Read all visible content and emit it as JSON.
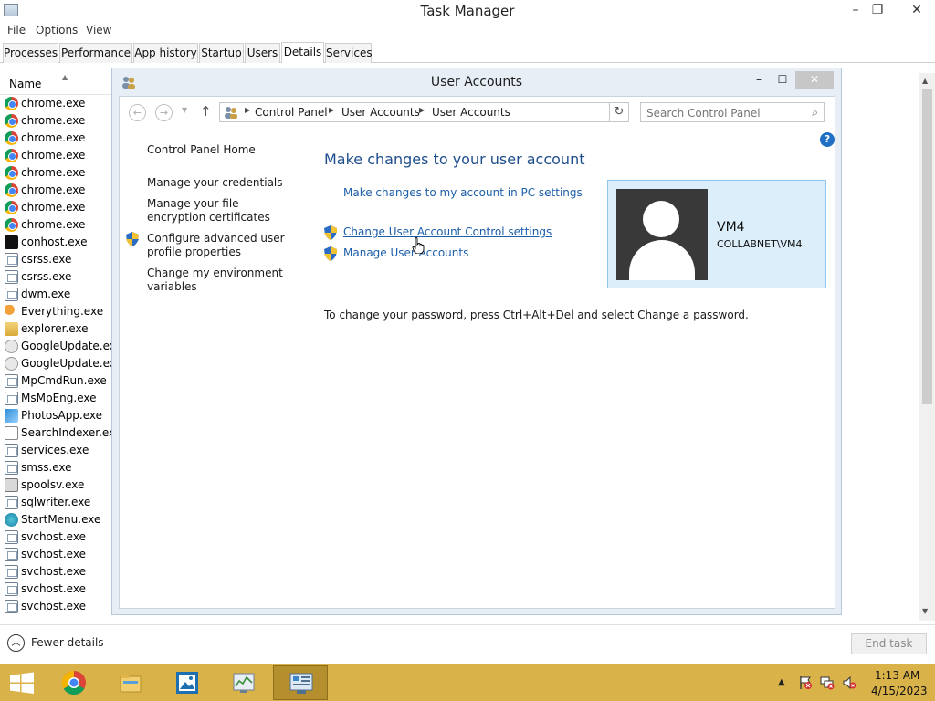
{
  "task_manager": {
    "title": "Task Manager",
    "menu": [
      "File",
      "Options",
      "View"
    ],
    "tabs": [
      "Processes",
      "Performance",
      "App history",
      "Startup",
      "Users",
      "Details",
      "Services"
    ],
    "active_tab": "Details",
    "column_header": "Name",
    "processes": [
      {
        "name": "chrome.exe",
        "icon": "chrome-icon"
      },
      {
        "name": "chrome.exe",
        "icon": "chrome-icon"
      },
      {
        "name": "chrome.exe",
        "icon": "chrome-icon"
      },
      {
        "name": "chrome.exe",
        "icon": "chrome-icon"
      },
      {
        "name": "chrome.exe",
        "icon": "chrome-icon"
      },
      {
        "name": "chrome.exe",
        "icon": "chrome-icon"
      },
      {
        "name": "chrome.exe",
        "icon": "chrome-icon"
      },
      {
        "name": "chrome.exe",
        "icon": "chrome-icon"
      },
      {
        "name": "conhost.exe",
        "icon": "console-icon"
      },
      {
        "name": "csrss.exe",
        "icon": "window-icon"
      },
      {
        "name": "csrss.exe",
        "icon": "window-icon"
      },
      {
        "name": "dwm.exe",
        "icon": "window-icon"
      },
      {
        "name": "Everything.exe",
        "icon": "magnifier-icon"
      },
      {
        "name": "explorer.exe",
        "icon": "folder-icon"
      },
      {
        "name": "GoogleUpdate.exe",
        "icon": "google-update-icon"
      },
      {
        "name": "GoogleUpdate.exe",
        "icon": "google-update-icon"
      },
      {
        "name": "MpCmdRun.exe",
        "icon": "window-icon"
      },
      {
        "name": "MsMpEng.exe",
        "icon": "window-icon"
      },
      {
        "name": "PhotosApp.exe",
        "icon": "photos-icon"
      },
      {
        "name": "SearchIndexer.exe",
        "icon": "search-indexer-icon"
      },
      {
        "name": "services.exe",
        "icon": "window-icon"
      },
      {
        "name": "smss.exe",
        "icon": "window-icon"
      },
      {
        "name": "spoolsv.exe",
        "icon": "printer-icon"
      },
      {
        "name": "sqlwriter.exe",
        "icon": "window-icon"
      },
      {
        "name": "StartMenu.exe",
        "icon": "startmenu-icon"
      },
      {
        "name": "svchost.exe",
        "icon": "window-icon"
      },
      {
        "name": "svchost.exe",
        "icon": "window-icon"
      },
      {
        "name": "svchost.exe",
        "icon": "window-icon"
      },
      {
        "name": "svchost.exe",
        "icon": "window-icon"
      },
      {
        "name": "svchost.exe",
        "icon": "window-icon"
      }
    ],
    "fewer_details": "Fewer details",
    "end_task": "End task"
  },
  "user_accounts": {
    "title": "User Accounts",
    "breadcrumbs": [
      "Control Panel",
      "User Accounts",
      "User Accounts"
    ],
    "search_placeholder": "Search Control Panel",
    "help": "?",
    "left_nav": {
      "home": "Control Panel Home",
      "credentials": "Manage your credentials",
      "encryption": "Manage your file encryption certificates",
      "profile": "Configure advanced user profile properties",
      "environment": "Change my environment variables"
    },
    "heading": "Make changes to your user account",
    "link_pc_settings": "Make changes to my account in PC settings",
    "link_uac": "Change User Account Control settings",
    "link_manage": "Manage User Accounts",
    "password_note": "To change your password, press Ctrl+Alt+Del and select Change a password.",
    "user": {
      "name": "VM4",
      "domain": "COLLABNET\\VM4"
    }
  },
  "taskbar": {
    "time": "1:13 AM",
    "date": "4/15/2023"
  },
  "colors": {
    "link": "#1c5ea9",
    "heading": "#1f4e8c",
    "taskbar": "#d9b24a",
    "tile_bg": "#dbeefa"
  }
}
